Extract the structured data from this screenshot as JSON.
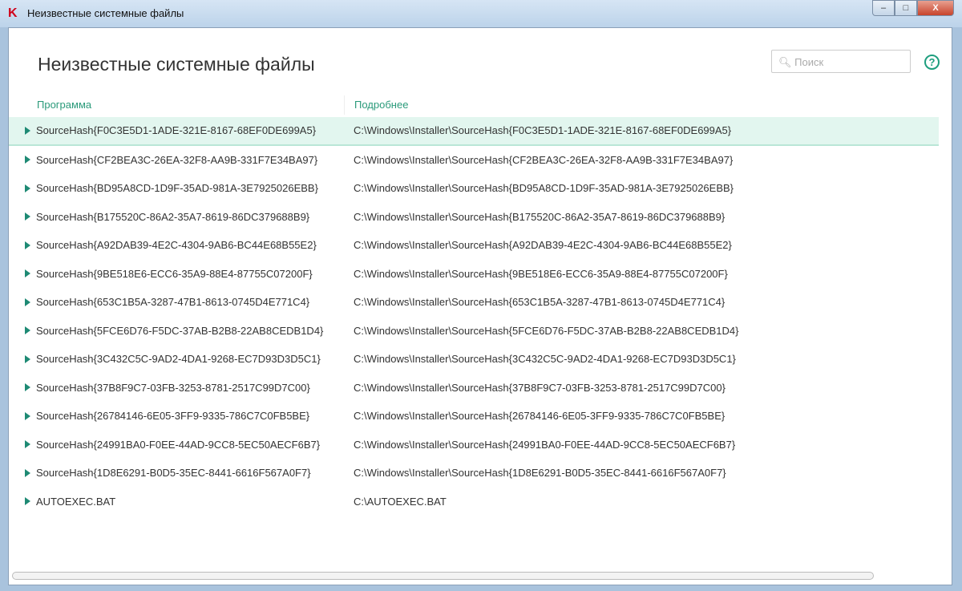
{
  "window": {
    "title": "Неизвестные системные файлы",
    "min": "–",
    "max": "□",
    "close": "X"
  },
  "header": {
    "title": "Неизвестные системные файлы",
    "search_placeholder": "Поиск",
    "help": "?"
  },
  "columns": {
    "program": "Программа",
    "details": "Подробнее"
  },
  "rows": [
    {
      "name": "SourceHash{F0C3E5D1-1ADE-321E-8167-68EF0DE699A5}",
      "path": "C:\\Windows\\Installer\\SourceHash{F0C3E5D1-1ADE-321E-8167-68EF0DE699A5}"
    },
    {
      "name": "SourceHash{CF2BEA3C-26EA-32F8-AA9B-331F7E34BA97}",
      "path": "C:\\Windows\\Installer\\SourceHash{CF2BEA3C-26EA-32F8-AA9B-331F7E34BA97}"
    },
    {
      "name": "SourceHash{BD95A8CD-1D9F-35AD-981A-3E7925026EBB}",
      "path": "C:\\Windows\\Installer\\SourceHash{BD95A8CD-1D9F-35AD-981A-3E7925026EBB}"
    },
    {
      "name": "SourceHash{B175520C-86A2-35A7-8619-86DC379688B9}",
      "path": "C:\\Windows\\Installer\\SourceHash{B175520C-86A2-35A7-8619-86DC379688B9}"
    },
    {
      "name": "SourceHash{A92DAB39-4E2C-4304-9AB6-BC44E68B55E2}",
      "path": "C:\\Windows\\Installer\\SourceHash{A92DAB39-4E2C-4304-9AB6-BC44E68B55E2}"
    },
    {
      "name": "SourceHash{9BE518E6-ECC6-35A9-88E4-87755C07200F}",
      "path": "C:\\Windows\\Installer\\SourceHash{9BE518E6-ECC6-35A9-88E4-87755C07200F}"
    },
    {
      "name": "SourceHash{653C1B5A-3287-47B1-8613-0745D4E771C4}",
      "path": "C:\\Windows\\Installer\\SourceHash{653C1B5A-3287-47B1-8613-0745D4E771C4}"
    },
    {
      "name": "SourceHash{5FCE6D76-F5DC-37AB-B2B8-22AB8CEDB1D4}",
      "path": "C:\\Windows\\Installer\\SourceHash{5FCE6D76-F5DC-37AB-B2B8-22AB8CEDB1D4}"
    },
    {
      "name": "SourceHash{3C432C5C-9AD2-4DA1-9268-EC7D93D3D5C1}",
      "path": "C:\\Windows\\Installer\\SourceHash{3C432C5C-9AD2-4DA1-9268-EC7D93D3D5C1}"
    },
    {
      "name": "SourceHash{37B8F9C7-03FB-3253-8781-2517C99D7C00}",
      "path": "C:\\Windows\\Installer\\SourceHash{37B8F9C7-03FB-3253-8781-2517C99D7C00}"
    },
    {
      "name": "SourceHash{26784146-6E05-3FF9-9335-786C7C0FB5BE}",
      "path": "C:\\Windows\\Installer\\SourceHash{26784146-6E05-3FF9-9335-786C7C0FB5BE}"
    },
    {
      "name": "SourceHash{24991BA0-F0EE-44AD-9CC8-5EC50AECF6B7}",
      "path": "C:\\Windows\\Installer\\SourceHash{24991BA0-F0EE-44AD-9CC8-5EC50AECF6B7}"
    },
    {
      "name": "SourceHash{1D8E6291-B0D5-35EC-8441-6616F567A0F7}",
      "path": "C:\\Windows\\Installer\\SourceHash{1D8E6291-B0D5-35EC-8441-6616F567A0F7}"
    },
    {
      "name": "AUTOEXEC.BAT",
      "path": "C:\\AUTOEXEC.BAT"
    }
  ]
}
